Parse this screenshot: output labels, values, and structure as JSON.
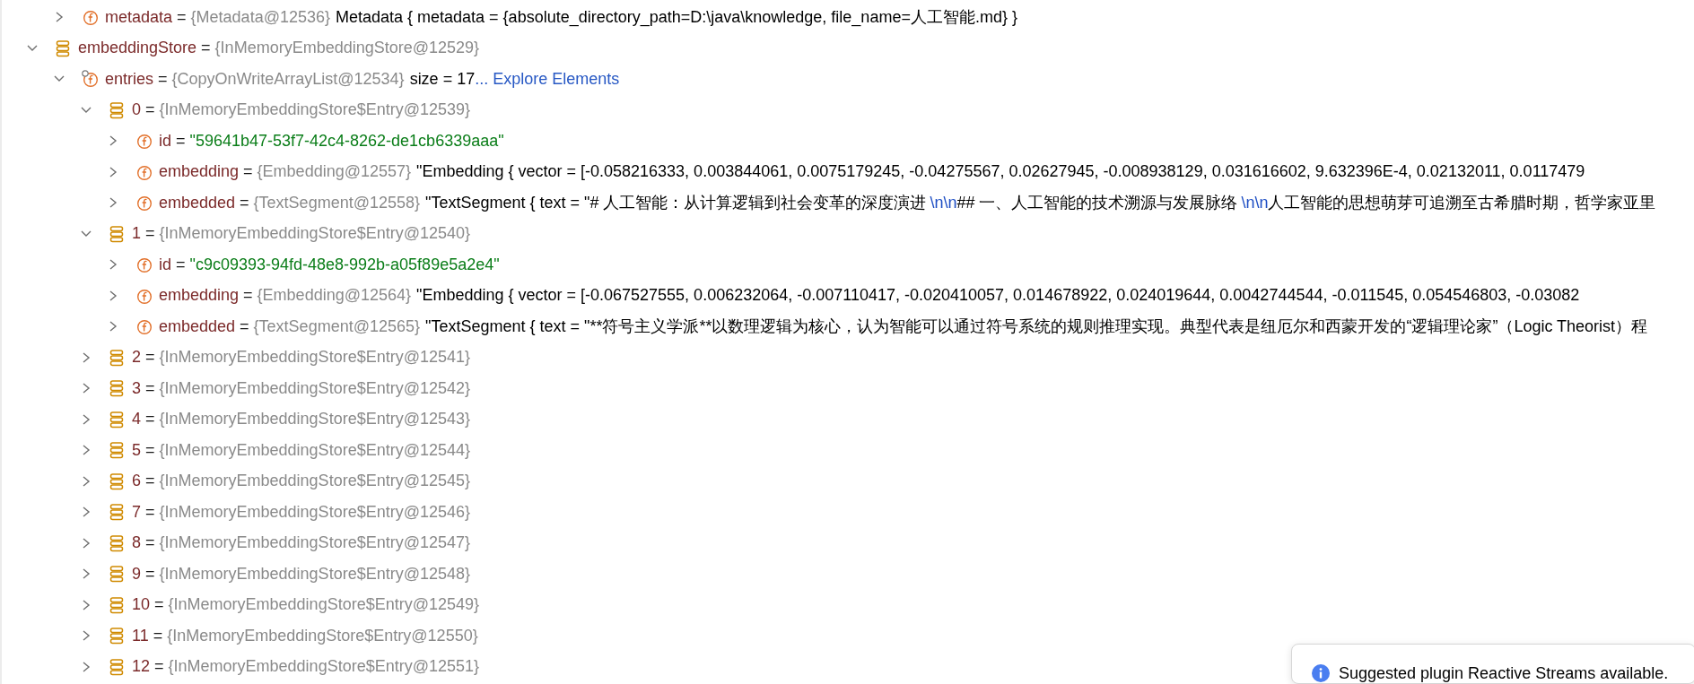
{
  "tree": [
    {
      "kind": "hidden-parent",
      "children": [
        {
          "kind": "field",
          "name": "metadata",
          "op": "=",
          "ref": "{Metadata@12536}",
          "expanded": false,
          "value": [
            {
              "kind": "text",
              "text": "Metadata { metadata = {absolute_directory_path=D:\\java\\knowledge, file_name=人工智能.md} }"
            }
          ]
        }
      ]
    },
    {
      "kind": "entry",
      "name": "embeddingStore",
      "op": "=",
      "ref": "{InMemoryEmbeddingStore@12529}",
      "expanded": true,
      "children": [
        {
          "kind": "field-marked",
          "name": "entries",
          "op": "=",
          "ref": "{CopyOnWriteArrayList@12534}",
          "expanded": true,
          "value": [
            {
              "kind": "text",
              "text": "size = 17"
            },
            {
              "kind": "link",
              "text": "... Explore Elements"
            }
          ],
          "children": [
            {
              "kind": "entry",
              "name": "0",
              "op": "=",
              "ref": "{InMemoryEmbeddingStore$Entry@12539}",
              "expanded": true,
              "children": [
                {
                  "kind": "field",
                  "name": "id",
                  "op": "=",
                  "expanded": false,
                  "value": [
                    {
                      "kind": "string",
                      "text": "\"59641b47-53f7-42c4-8262-de1cb6339aaa\""
                    }
                  ]
                },
                {
                  "kind": "field",
                  "name": "embedding",
                  "op": "=",
                  "ref": "{Embedding@12557}",
                  "expanded": false,
                  "value": [
                    {
                      "kind": "text",
                      "text": "\"Embedding { vector = [-0.058216333, 0.003844061, 0.0075179245, -0.04275567, 0.02627945, -0.008938129, 0.031616602, 9.632396E-4, 0.02132011, 0.0117479"
                    }
                  ]
                },
                {
                  "kind": "field",
                  "name": "embedded",
                  "op": "=",
                  "ref": "{TextSegment@12558}",
                  "expanded": false,
                  "value": [
                    {
                      "kind": "text",
                      "text": "\"TextSegment { text = \"# 人工智能：从计算逻辑到社会变革的深度演进"
                    },
                    {
                      "kind": "escape",
                      "text": "\\n\\n"
                    },
                    {
                      "kind": "text",
                      "text": "## 一、人工智能的技术溯源与发展脉络"
                    },
                    {
                      "kind": "escape",
                      "text": "\\n\\n"
                    },
                    {
                      "kind": "text",
                      "text": "人工智能的思想萌芽可追溯至古希腊时期，哲学家亚里"
                    }
                  ]
                }
              ]
            },
            {
              "kind": "entry",
              "name": "1",
              "op": "=",
              "ref": "{InMemoryEmbeddingStore$Entry@12540}",
              "expanded": true,
              "children": [
                {
                  "kind": "field",
                  "name": "id",
                  "op": "=",
                  "expanded": false,
                  "value": [
                    {
                      "kind": "string",
                      "text": "\"c9c09393-94fd-48e8-992b-a05f89e5a2e4\""
                    }
                  ]
                },
                {
                  "kind": "field",
                  "name": "embedding",
                  "op": "=",
                  "ref": "{Embedding@12564}",
                  "expanded": false,
                  "value": [
                    {
                      "kind": "text",
                      "text": "\"Embedding { vector = [-0.067527555, 0.006232064, -0.007110417, -0.020410057, 0.014678922, 0.024019644, 0.0042744544, -0.011545, 0.054546803, -0.03082"
                    }
                  ]
                },
                {
                  "kind": "field",
                  "name": "embedded",
                  "op": "=",
                  "ref": "{TextSegment@12565}",
                  "expanded": false,
                  "value": [
                    {
                      "kind": "text",
                      "text": "\"TextSegment { text = \"**符号主义学派**以数理逻辑为核心，认为智能可以通过符号系统的规则推理实现。典型代表是纽厄尔和西蒙开发的“逻辑理论家”（Logic Theorist）程"
                    }
                  ]
                }
              ]
            },
            {
              "kind": "entry",
              "name": "2",
              "op": "=",
              "ref": "{InMemoryEmbeddingStore$Entry@12541}",
              "expanded": false
            },
            {
              "kind": "entry",
              "name": "3",
              "op": "=",
              "ref": "{InMemoryEmbeddingStore$Entry@12542}",
              "expanded": false
            },
            {
              "kind": "entry",
              "name": "4",
              "op": "=",
              "ref": "{InMemoryEmbeddingStore$Entry@12543}",
              "expanded": false
            },
            {
              "kind": "entry",
              "name": "5",
              "op": "=",
              "ref": "{InMemoryEmbeddingStore$Entry@12544}",
              "expanded": false
            },
            {
              "kind": "entry",
              "name": "6",
              "op": "=",
              "ref": "{InMemoryEmbeddingStore$Entry@12545}",
              "expanded": false
            },
            {
              "kind": "entry",
              "name": "7",
              "op": "=",
              "ref": "{InMemoryEmbeddingStore$Entry@12546}",
              "expanded": false
            },
            {
              "kind": "entry",
              "name": "8",
              "op": "=",
              "ref": "{InMemoryEmbeddingStore$Entry@12547}",
              "expanded": false
            },
            {
              "kind": "entry",
              "name": "9",
              "op": "=",
              "ref": "{InMemoryEmbeddingStore$Entry@12548}",
              "expanded": false
            },
            {
              "kind": "entry",
              "name": "10",
              "op": "=",
              "ref": "{InMemoryEmbeddingStore$Entry@12549}",
              "expanded": false
            },
            {
              "kind": "entry",
              "name": "11",
              "op": "=",
              "ref": "{InMemoryEmbeddingStore$Entry@12550}",
              "expanded": false
            },
            {
              "kind": "entry",
              "name": "12",
              "op": "=",
              "ref": "{InMemoryEmbeddingStore$Entry@12551}",
              "expanded": false
            }
          ]
        }
      ]
    }
  ],
  "notification": {
    "text": "Suggested plugin Reactive Streams available."
  }
}
